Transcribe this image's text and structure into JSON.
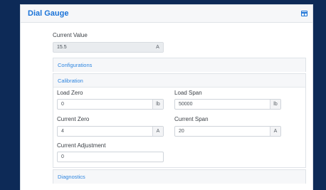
{
  "header": {
    "title": "Dial Gauge",
    "panel_icon": "panel-layout-icon"
  },
  "current_value": {
    "label": "Current Value",
    "value": "15.5",
    "unit": "A"
  },
  "sections": {
    "configurations": {
      "title": "Configurations"
    },
    "calibration": {
      "title": "Calibration",
      "load_zero": {
        "label": "Load Zero",
        "value": "0",
        "unit": "lb"
      },
      "load_span": {
        "label": "Load Span",
        "value": "50000",
        "unit": "lb"
      },
      "current_zero": {
        "label": "Current Zero",
        "value": "4",
        "unit": "A"
      },
      "current_span": {
        "label": "Current Span",
        "value": "20",
        "unit": "A"
      },
      "current_adjustment": {
        "label": "Current Adjustment",
        "value": "0"
      }
    },
    "diagnostics": {
      "title": "Diagnostics"
    }
  },
  "colors": {
    "accent": "#1a73d8",
    "background": "#0d2a57"
  }
}
